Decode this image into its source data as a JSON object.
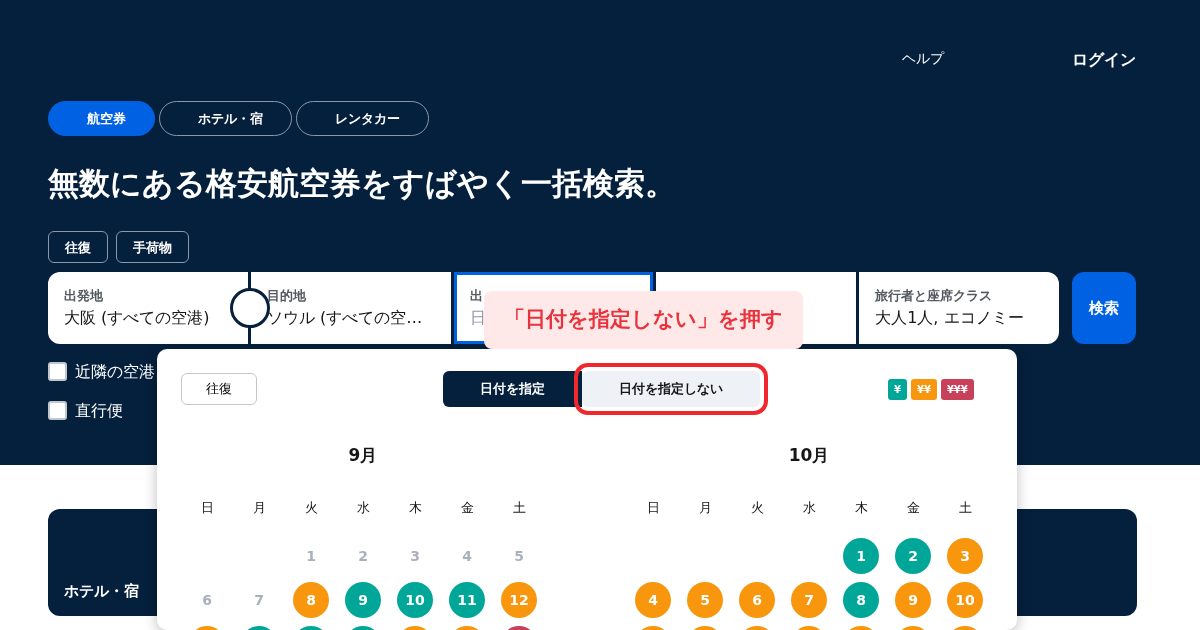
{
  "nav_links": [
    {
      "label": "ヘルプ",
      "bold": false
    },
    {
      "label": "ログイン",
      "bold": true
    }
  ],
  "tabs": [
    {
      "label": "航空券",
      "selected": true
    },
    {
      "label": "ホテル・宿",
      "selected": false
    },
    {
      "label": "レンタカー",
      "selected": false
    }
  ],
  "headline": "無数にある格安航空券をすばやく一括検索。",
  "trip_options": [
    "往復",
    "手荷物"
  ],
  "search_fields": [
    {
      "label": "出発地",
      "value": "大阪 (すべての空港)",
      "focused": false
    },
    {
      "label": "目的地",
      "value": "ソウル (すべての空…",
      "focused": false
    },
    {
      "label": "出",
      "placeholder": "日",
      "focused": true
    },
    {
      "focused": false
    },
    {
      "label": "旅行者と座席クラス",
      "value": "大人1人, エコノミー",
      "focused": false
    }
  ],
  "search_button": "検索",
  "filters": [
    {
      "label": "近隣の空港",
      "checked": false
    },
    {
      "label": "直行便",
      "checked": false
    }
  ],
  "date_picker": {
    "trip_type": "往復",
    "modes": [
      {
        "label": "日付を指定",
        "selected": true,
        "highlighted": false
      },
      {
        "label": "日付を指定しない",
        "selected": false,
        "highlighted": true
      }
    ],
    "legend": [
      {
        "label": "¥",
        "color": "#00a698"
      },
      {
        "label": "¥¥",
        "color": "#f8960e"
      },
      {
        "label": "¥¥¥",
        "color": "#c9405b"
      }
    ],
    "months": [
      {
        "title": "9月",
        "weekdays": [
          "日",
          "月",
          "火",
          "水",
          "木",
          "金",
          "土"
        ],
        "weeks": [
          [
            {
              "kind": "blank"
            },
            {
              "kind": "blank"
            },
            {
              "day": "1",
              "disabled": true
            },
            {
              "day": "2",
              "disabled": true
            },
            {
              "day": "3",
              "disabled": true
            },
            {
              "day": "4",
              "disabled": true
            },
            {
              "day": "5",
              "disabled": true
            }
          ],
          [
            {
              "day": "6",
              "disabled": true
            },
            {
              "day": "7",
              "disabled": true
            },
            {
              "day": "8",
              "color": "#f8960e"
            },
            {
              "day": "9",
              "color": "#00a698"
            },
            {
              "day": "10",
              "color": "#00a698"
            },
            {
              "day": "11",
              "color": "#00a698"
            },
            {
              "day": "12",
              "color": "#f8960e"
            }
          ],
          [
            {
              "color": "#f8960e"
            },
            {
              "color": "#00a698"
            },
            {
              "color": "#00a698"
            },
            {
              "color": "#00a698"
            },
            {
              "color": "#f8960e"
            },
            {
              "color": "#f8960e"
            },
            {
              "color": "#c9405b"
            }
          ]
        ]
      },
      {
        "title": "10月",
        "weekdays": [
          "日",
          "月",
          "火",
          "水",
          "木",
          "金",
          "土"
        ],
        "weeks": [
          [
            {
              "kind": "blank"
            },
            {
              "kind": "blank"
            },
            {
              "kind": "blank"
            },
            {
              "kind": "blank"
            },
            {
              "day": "1",
              "color": "#00a698"
            },
            {
              "day": "2",
              "color": "#00a698"
            },
            {
              "day": "3",
              "color": "#f8960e"
            }
          ],
          [
            {
              "day": "4",
              "color": "#f8960e"
            },
            {
              "day": "5",
              "color": "#f8960e"
            },
            {
              "day": "6",
              "color": "#f8960e"
            },
            {
              "day": "7",
              "color": "#f8960e"
            },
            {
              "day": "8",
              "color": "#00a698"
            },
            {
              "day": "9",
              "color": "#f8960e"
            },
            {
              "day": "10",
              "color": "#f8960e"
            }
          ],
          [
            {
              "color": "#f8960e"
            },
            {
              "color": "#f8960e"
            },
            {
              "color": "#f8960e"
            },
            {
              "color": "#f8960e"
            },
            {
              "color": "#f8960e"
            },
            {
              "color": "#f8960e"
            },
            {
              "color": "#f8960e"
            }
          ]
        ]
      }
    ]
  },
  "callout": "「日付を指定しない」を押す",
  "cards": [
    {
      "title": "ホテル・宿"
    }
  ]
}
